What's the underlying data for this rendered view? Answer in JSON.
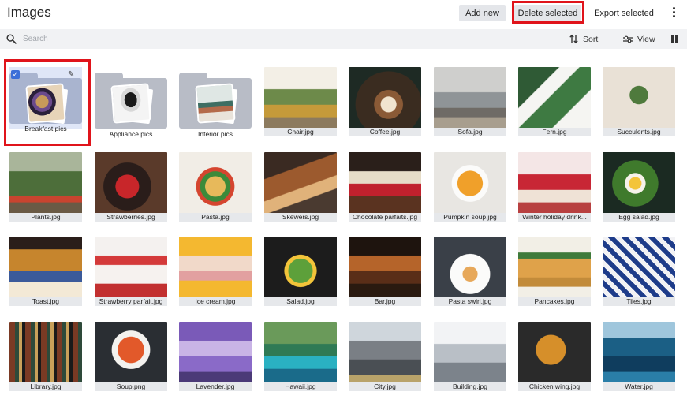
{
  "header": {
    "title": "Images",
    "add_new": "Add new",
    "delete_selected": "Delete selected",
    "export_selected": "Export selected"
  },
  "search": {
    "placeholder": "Search"
  },
  "toolbar": {
    "sort": "Sort",
    "view": "View"
  },
  "folders": [
    {
      "name": "Breakfast pics",
      "selected": true
    },
    {
      "name": "Appliance pics",
      "selected": false
    },
    {
      "name": "Interior pics",
      "selected": false
    }
  ],
  "images": [
    "Chair.jpg",
    "Coffee.jpg",
    "Sofa.jpg",
    "Fern.jpg",
    "Succulents.jpg",
    "Plants.jpg",
    "Strawberries.jpg",
    "Pasta.jpg",
    "Skewers.jpg",
    "Chocolate parfaits.jpg",
    "Pumpkin soup.jpg",
    "Winter holiday drink...",
    "Egg salad.jpg",
    "Toast.jpg",
    "Strawberry parfait.jpg",
    "Ice cream.jpg",
    "Salad.jpg",
    "Bar.jpg",
    "Pasta swirl.jpg",
    "Pancakes.jpg",
    "Tiles.jpg",
    "Library.jpg",
    "Soup.png",
    "Lavender.jpg",
    "Hawaii.jpg",
    "City.jpg",
    "Building.jpg",
    "Chicken wing.jpg",
    "Water.jpg"
  ]
}
